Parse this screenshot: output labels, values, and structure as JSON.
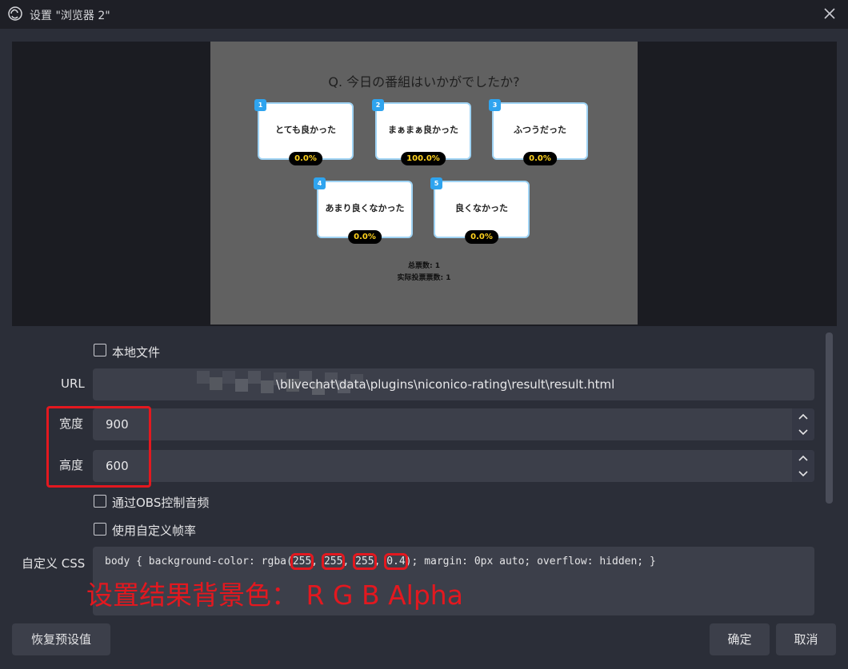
{
  "window": {
    "title": "设置 \"浏览器 2\""
  },
  "preview": {
    "question": "Q. 今日の番組はいかがでしたか?",
    "options": [
      {
        "num": "1",
        "label": "とても良かった",
        "percent": "0.0%"
      },
      {
        "num": "2",
        "label": "まぁまぁ良かった",
        "percent": "100.0%"
      },
      {
        "num": "3",
        "label": "ふつうだった",
        "percent": "0.0%"
      },
      {
        "num": "4",
        "label": "あまり良くなかった",
        "percent": "0.0%"
      },
      {
        "num": "5",
        "label": "良くなかった",
        "percent": "0.0%"
      }
    ],
    "total_votes": "总票数: 1",
    "actual_votes": "实际投票票数: 1"
  },
  "form": {
    "local_file_label": "本地文件",
    "url_label": "URL",
    "url_value": "\\blivechat\\data\\plugins\\niconico-rating\\result\\result.html",
    "width_label": "宽度",
    "width_value": "900",
    "height_label": "高度",
    "height_value": "600",
    "obs_audio_label": "通过OBS控制音频",
    "custom_fps_label": "使用自定义帧率",
    "custom_css_label": "自定义 CSS",
    "css": {
      "prefix": "body { background-color: rgba",
      "r": "255",
      "g": "255",
      "b": "255",
      "a": "0.4",
      "suffix": "; margin: 0px auto; overflow: hidden; }"
    }
  },
  "annotation": "设置结果背景色： R G B Alpha",
  "buttons": {
    "reset": "恢复预设值",
    "ok": "确定",
    "cancel": "取消"
  },
  "colors": {
    "annotation_red": "#e3181f",
    "card_border": "#9fd3f4",
    "percent_text": "#ffd21e",
    "badge_blue": "#2fa4ef"
  },
  "icons": [
    "obs-logo-icon",
    "close-icon",
    "chevron-up-icon",
    "chevron-down-icon"
  ]
}
